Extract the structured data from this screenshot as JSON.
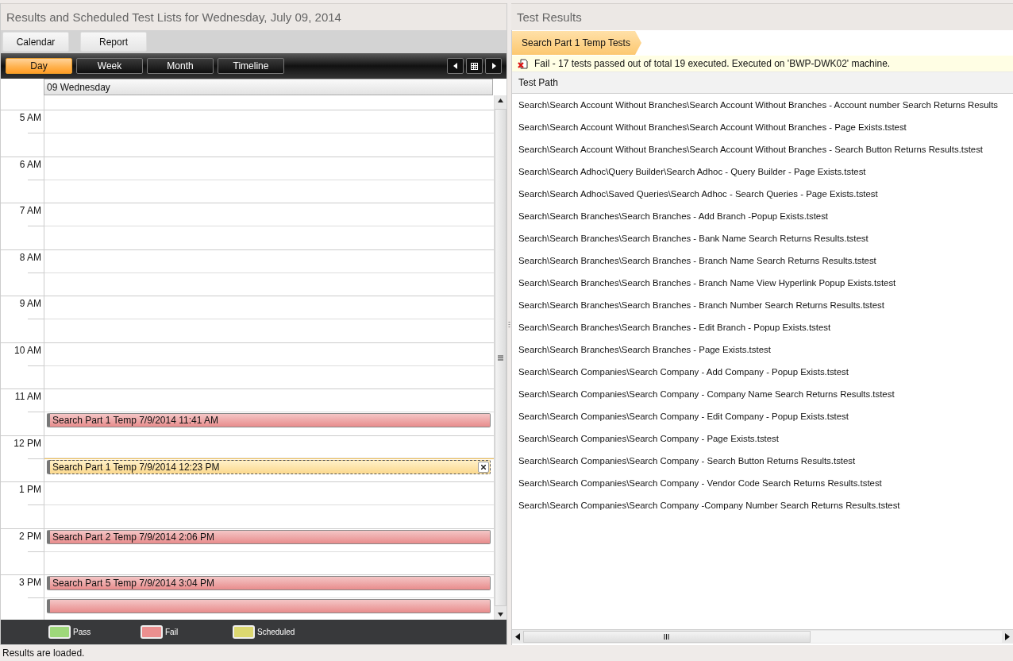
{
  "left_panel": {
    "title": "Results and Scheduled Test Lists for Wednesday, July 09, 2014",
    "buttons": [
      "Calendar",
      "Report"
    ],
    "view_tabs": [
      {
        "label": "Day",
        "selected": true
      },
      {
        "label": "Week",
        "selected": false
      },
      {
        "label": "Month",
        "selected": false
      },
      {
        "label": "Timeline",
        "selected": false
      }
    ],
    "calendar": {
      "day_header": "09 Wednesday",
      "hours": [
        {
          "label": "5 AM"
        },
        {
          "label": "6 AM"
        },
        {
          "label": "7 AM"
        },
        {
          "label": "8 AM"
        },
        {
          "label": "9 AM"
        },
        {
          "label": "10 AM"
        },
        {
          "label": "11 AM",
          "second_half_events": [
            {
              "label": "Search Part 1 Temp 7/9/2014 11:41 AM",
              "kind": "fail",
              "selected": false
            }
          ]
        },
        {
          "label": "12 PM",
          "second_half_events": [
            {
              "label": "Search Part 1 Temp 7/9/2014 12:23 PM",
              "kind": "fail",
              "selected": true
            }
          ]
        },
        {
          "label": "1 PM"
        },
        {
          "label": "2 PM",
          "first_half_events": [
            {
              "label": "Search Part 2 Temp 7/9/2014 2:06 PM",
              "kind": "fail",
              "selected": false
            }
          ]
        },
        {
          "label": "3 PM",
          "first_half_events": [
            {
              "label": "Search Part 5 Temp 7/9/2014 3:04 PM",
              "kind": "fail",
              "selected": false
            }
          ],
          "second_half_events": [
            {
              "kind": "fail",
              "selected": false
            }
          ]
        }
      ]
    },
    "legend": [
      {
        "label": "Pass",
        "color": "#9ed87a"
      },
      {
        "label": "Fail",
        "color": "#eb8f8f"
      },
      {
        "label": "Scheduled",
        "color": "#dcd870"
      }
    ]
  },
  "right_panel": {
    "title": "Test Results",
    "breadcrumb": "Search Part 1 Temp Tests",
    "result_message": "Fail - 17 tests passed out of total 19 executed. Executed on 'BWP-DWK02' machine.",
    "table": {
      "columns": [
        "Test Path"
      ],
      "rows": [
        "Search\\Search Account Without Branches\\Search Account Without Branches - Account number Search Returns Results",
        "Search\\Search Account Without Branches\\Search Account Without Branches - Page Exists.tstest",
        "Search\\Search Account Without Branches\\Search Account Without Branches - Search Button Returns Results.tstest",
        "Search\\Search Adhoc\\Query Builder\\Search Adhoc - Query Builder - Page Exists.tstest",
        "Search\\Search Adhoc\\Saved Queries\\Search Adhoc - Search Queries - Page Exists.tstest",
        "Search\\Search Branches\\Search Branches - Add Branch -Popup Exists.tstest",
        "Search\\Search Branches\\Search Branches - Bank Name Search Returns Results.tstest",
        "Search\\Search Branches\\Search Branches - Branch Name Search Returns Results.tstest",
        "Search\\Search Branches\\Search Branches - Branch Name View Hyperlink Popup Exists.tstest",
        "Search\\Search Branches\\Search Branches - Branch Number Search Returns Results.tstest",
        "Search\\Search Branches\\Search Branches - Edit Branch - Popup Exists.tstest",
        "Search\\Search Branches\\Search Branches - Page Exists.tstest",
        "Search\\Search Companies\\Search Company - Add Company - Popup Exists.tstest",
        "Search\\Search Companies\\Search Company - Company Name Search Returns Results.tstest",
        "Search\\Search Companies\\Search Company - Edit Company - Popup Exists.tstest",
        "Search\\Search Companies\\Search Company - Page Exists.tstest",
        "Search\\Search Companies\\Search Company - Search Button Returns Results.tstest",
        "Search\\Search Companies\\Search Company - Vendor Code Search Returns Results.tstest",
        "Search\\Search Companies\\Search Company -Company Number Search Returns Results.tstest"
      ]
    }
  },
  "status_bar": "Results are loaded."
}
